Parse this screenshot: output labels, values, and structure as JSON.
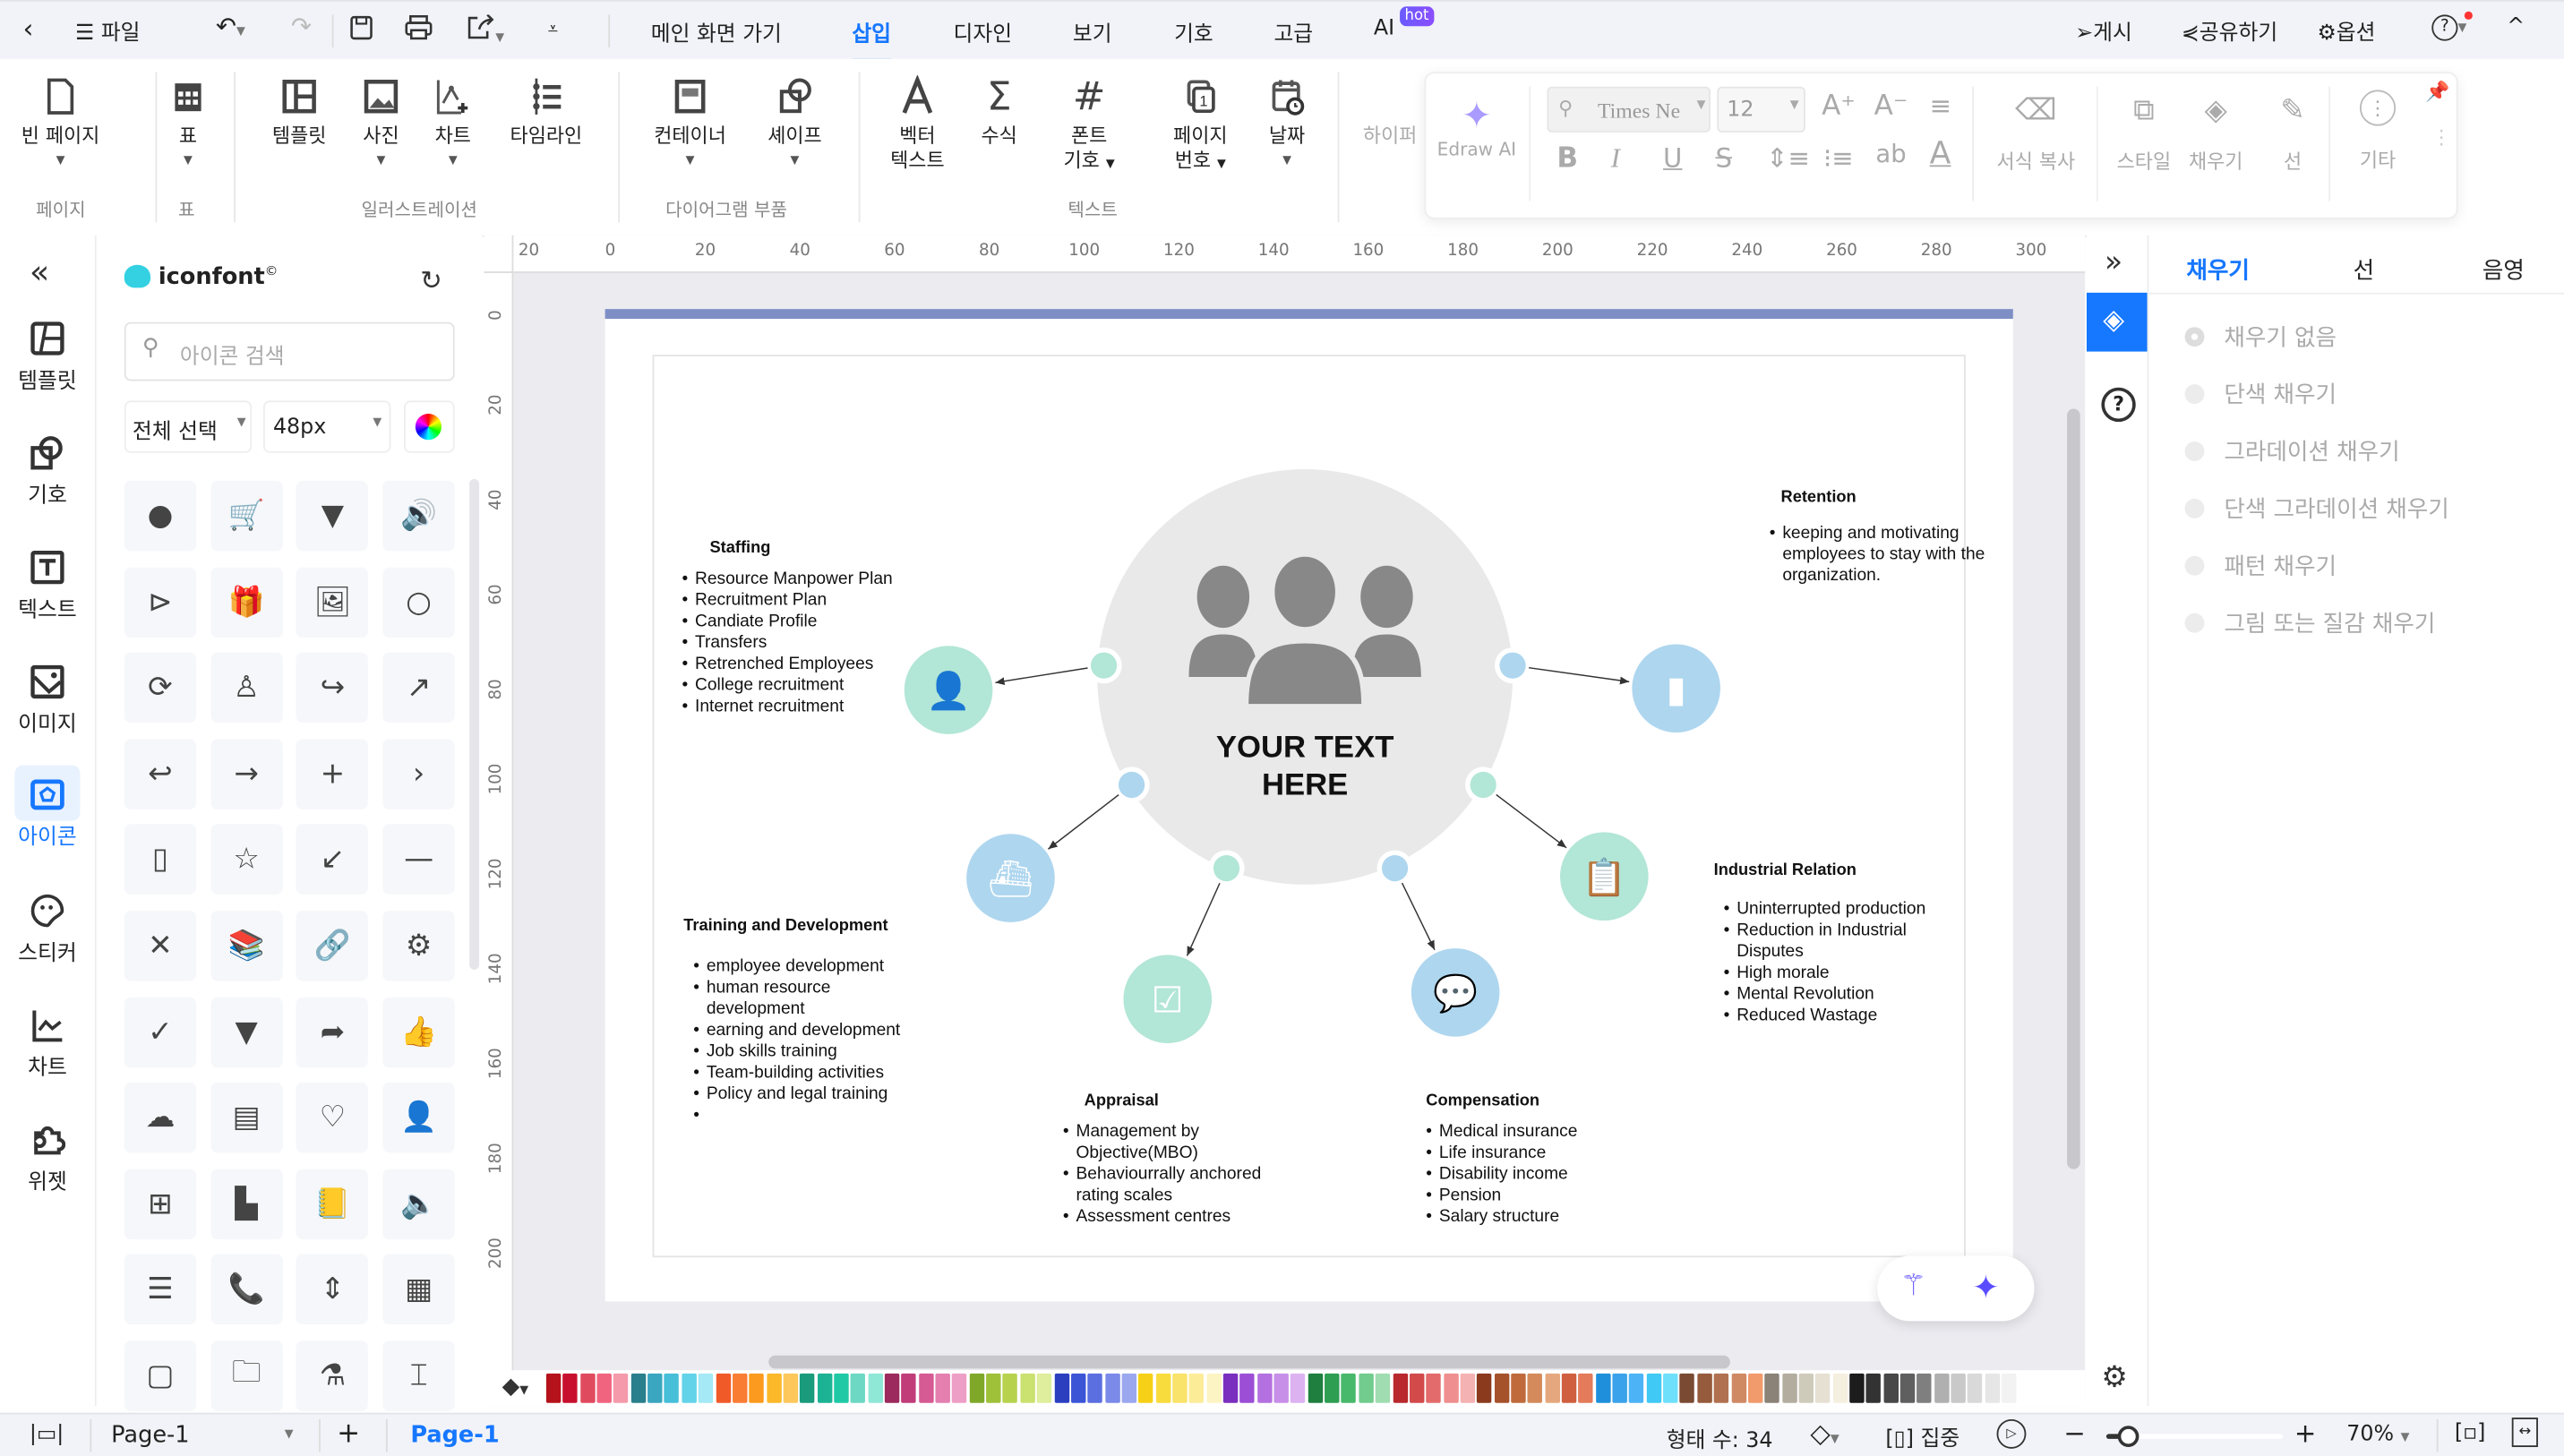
{
  "topbar": {
    "file_label": "파일",
    "tabs": [
      "메인 화면 가기",
      "삽입",
      "디자인",
      "보기",
      "기호",
      "고급",
      "AI"
    ],
    "active_tab": "삽입",
    "hot_badge": "hot",
    "publish": "게시",
    "share": "공유하기",
    "options": "옵션"
  },
  "ribbon": {
    "buttons": {
      "blank_page": "빈 페이지",
      "table": "표",
      "template": "템플릿",
      "photo": "사진",
      "chart": "차트",
      "timeline": "타임라인",
      "container": "컨테이너",
      "shape": "셰이프",
      "vector_text_1": "벡터",
      "vector_text_2": "텍스트",
      "formula": "수식",
      "font_symbol_1": "폰트",
      "font_symbol_2": "기호",
      "page_number_1": "페이지",
      "page_number_2": "번호",
      "date": "날짜",
      "hyperlink": "하이퍼"
    },
    "groups": {
      "page": "페이지",
      "table": "표",
      "illustration": "일러스트레이션",
      "diagram_parts": "다이어그램 부품",
      "text": "텍스트"
    }
  },
  "format_panel": {
    "edraw_ai": "Edraw AI",
    "font_family": "Times Ne",
    "font_size": "12",
    "format_painter": "서식 복사",
    "style": "스타일",
    "fill": "채우기",
    "line": "선",
    "more": "기타"
  },
  "rail": {
    "items": [
      {
        "label": "템플릿",
        "icon": "template-icon"
      },
      {
        "label": "기호",
        "icon": "symbol-icon"
      },
      {
        "label": "텍스트",
        "icon": "text-icon"
      },
      {
        "label": "이미지",
        "icon": "image-icon"
      },
      {
        "label": "아이콘",
        "icon": "icon-library-icon",
        "active": true
      },
      {
        "label": "스티커",
        "icon": "sticker-icon"
      },
      {
        "label": "차트",
        "icon": "chart-icon"
      },
      {
        "label": "위젯",
        "icon": "widget-icon"
      }
    ]
  },
  "library": {
    "brand": "iconfont",
    "search_placeholder": "아이콘 검색",
    "select_all": "전체 선택",
    "size": "48px",
    "icons": [
      "user",
      "cart",
      "caret-down",
      "speaker",
      "play-circle",
      "gift",
      "picture",
      "search",
      "sync-disabled",
      "user-outline",
      "share-arrow",
      "arrow-up-right",
      "reply",
      "arrow-right",
      "plus",
      "chevron-right",
      "mobile",
      "star",
      "arrow-down-left",
      "minus",
      "close",
      "books",
      "link",
      "gear",
      "check-circle",
      "filter",
      "forward",
      "thumbs-up",
      "cloud-upload",
      "contact-card",
      "chat-heart",
      "user-settings",
      "apps",
      "file-settings",
      "address-book",
      "volume",
      "list-bubble",
      "phone-ring",
      "sort",
      "grid",
      "grid-outline",
      "folder-doc",
      "flask",
      "pump"
    ]
  },
  "ruler": {
    "h": [
      "20",
      "0",
      "20",
      "40",
      "60",
      "80",
      "100",
      "120",
      "140",
      "160",
      "180",
      "200",
      "220",
      "240",
      "260",
      "280",
      "300"
    ],
    "v": [
      "0",
      "20",
      "40",
      "60",
      "80",
      "100",
      "120",
      "140",
      "160",
      "180",
      "200"
    ]
  },
  "diagram": {
    "center_line1": "YOUR TEXT",
    "center_line2": "HERE",
    "staffing": {
      "title": "Staffing",
      "items": [
        "Resource Manpower Plan",
        "Recruitment Plan",
        "Candiate Profile",
        "Transfers",
        "Retrenched Employees",
        "College recruitment",
        "Internet recruitment"
      ]
    },
    "training": {
      "title": "Training and Development",
      "items": [
        "employee development",
        "human resource development",
        "earning and development",
        "Job skills training",
        "Team-building activities",
        "Policy and legal training",
        ""
      ]
    },
    "appraisal": {
      "title": "Appraisal",
      "items": [
        "Management by Objective(MBO)",
        "Behaviourrally anchored rating scales",
        "Assessment centres"
      ]
    },
    "compensation": {
      "title": "Compensation",
      "items": [
        "Medical insurance",
        "Life insurance",
        "Disability income",
        "Pension",
        "Salary structure"
      ]
    },
    "retention": {
      "title": "Retention",
      "items": [
        "keeping and motivating employees to stay with the organization."
      ]
    },
    "industrial": {
      "title": "Industrial Relation",
      "items": [
        "Uninterrupted production",
        "Reduction in Industrial Disputes",
        "High morale",
        "Mental Revolution",
        "Reduced Wastage"
      ]
    },
    "colors": {
      "green": "#b2e6d6",
      "blue": "#aed6ef",
      "center": "#e9e9e9",
      "person": "#888888",
      "header_bar": "#7f8fc6"
    }
  },
  "right_panel": {
    "tabs": [
      "채우기",
      "선",
      "음영"
    ],
    "active_tab": "채우기",
    "options": [
      "채우기 없음",
      "단색 채우기",
      "그라데이션 채우기",
      "단색 그라데이션 채우기",
      "패턴 채우기",
      "그림 또는 질감 채우기"
    ]
  },
  "palette": [
    "#b5121b",
    "#c8102e",
    "#e04a5f",
    "#f06480",
    "#f59aaa",
    "#2a7f8c",
    "#3aa6c0",
    "#47bfd9",
    "#63d3ea",
    "#a4e9f5",
    "#f05a28",
    "#fa7d34",
    "#fb9a1e",
    "#fbb829",
    "#fdc75b",
    "#1a9b7b",
    "#1cb394",
    "#20c9a6",
    "#6dd8c3",
    "#8fe8d6",
    "#9c2a5c",
    "#c13d7a",
    "#d65a94",
    "#e47fb0",
    "#ee9fc6",
    "#7fa829",
    "#9fc13a",
    "#b7d24d",
    "#cbe170",
    "#dfee9c",
    "#2b3fbf",
    "#3c55d6",
    "#5b6fe0",
    "#7b8ae8",
    "#9ba7ef",
    "#f6d017",
    "#f8dc3e",
    "#fae36a",
    "#fcec97",
    "#fdf4c4",
    "#7b2fbf",
    "#9c4fd6",
    "#b470e0",
    "#c88fe8",
    "#dcb2f1",
    "#1e7f3f",
    "#2e9e52",
    "#48b86b",
    "#72cc8d",
    "#a0ddb1",
    "#b8282d",
    "#d24a4a",
    "#e46b6b",
    "#ef8f8f",
    "#f5b2b2",
    "#8c3a1d",
    "#a5522b",
    "#c06a3c",
    "#d48a5a",
    "#e5a87e",
    "#d05f3f",
    "#e47b5a",
    "#1f8fdb",
    "#3aa2ea",
    "#4cb4f6",
    "#40c9f5",
    "#6fe0fb",
    "#7a4a32",
    "#965a3c",
    "#b07150",
    "#d08a63",
    "#f19a6c",
    "#8c8378",
    "#b2ad9e",
    "#cfcbbb",
    "#e5e0d2",
    "#f5efe0",
    "#1c1c1c",
    "#333333",
    "#484848",
    "#5f5f5f",
    "#7f7f7f",
    "#b0b0b0",
    "#c9c9c9",
    "#d9d9d9",
    "#e6e6e6",
    "#f2f2f2"
  ],
  "statusbar": {
    "page_select": "Page-1",
    "page_tab": "Page-1",
    "shape_count": "형태 수: 34",
    "focus": "집중",
    "zoom": "70%",
    "zoom_level": 0.1
  }
}
